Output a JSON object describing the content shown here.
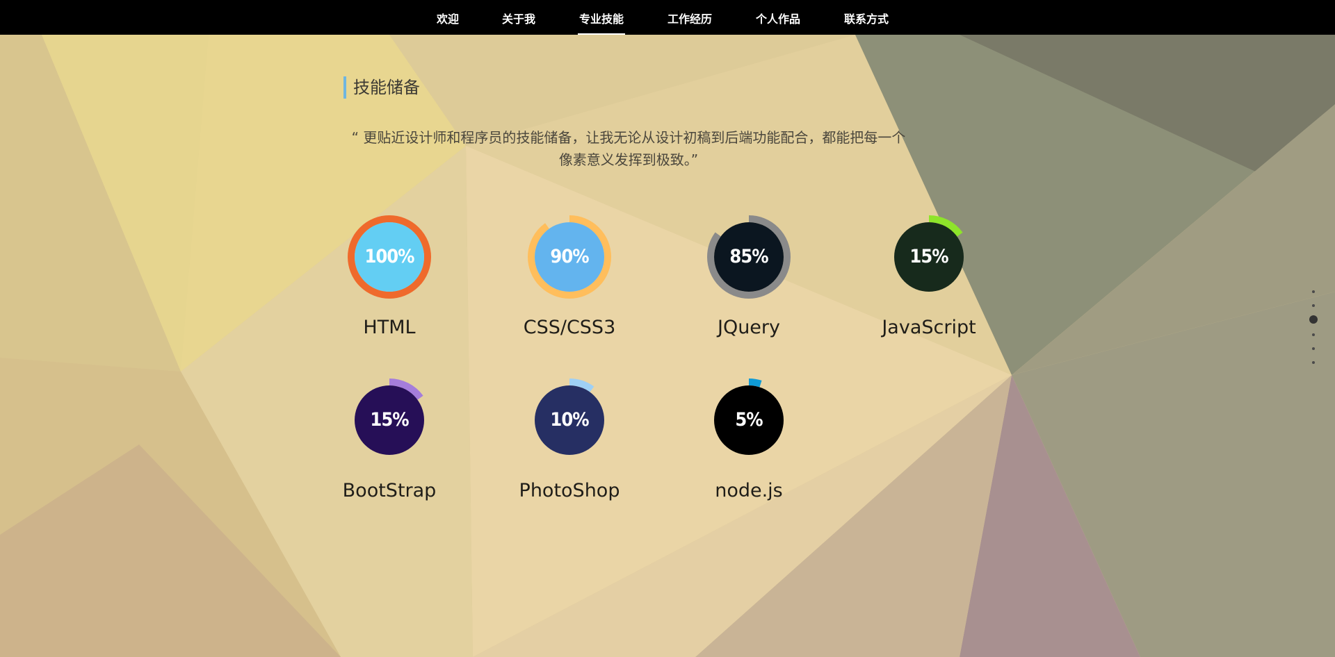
{
  "nav": {
    "items": [
      {
        "label": "欢迎",
        "active": false
      },
      {
        "label": "关于我",
        "active": false
      },
      {
        "label": "专业技能",
        "active": true
      },
      {
        "label": "工作经历",
        "active": false
      },
      {
        "label": "个人作品",
        "active": false
      },
      {
        "label": "联系方式",
        "active": false
      }
    ]
  },
  "section": {
    "title": "技能储备",
    "quote": "“ 更贴近设计师和程序员的技能储备，让我无论从设计初稿到后端功能配合，都能把每一个像素意义发挥到极致。”"
  },
  "skills": [
    {
      "name": "HTML",
      "percent_label": "100%",
      "percent": 100,
      "ring_color": "#ef6a2c",
      "track_color": "#ef6a2c",
      "fill_color": "#63cef3"
    },
    {
      "name": "CSS/CSS3",
      "percent_label": "90%",
      "percent": 90,
      "ring_color": "#ffbe5c",
      "track_color": "#ffbe5c",
      "fill_color": "#63b4ee"
    },
    {
      "name": "JQuery",
      "percent_label": "85%",
      "percent": 85,
      "ring_color": "#8a8a8a",
      "track_color": "#8a8a8a",
      "fill_color": "#0b1620"
    },
    {
      "name": "JavaScript",
      "percent_label": "15%",
      "percent": 15,
      "ring_color": "#8ee42a",
      "track_color": "#8ee42a",
      "fill_color": "#172a1c"
    },
    {
      "name": "BootStrap",
      "percent_label": "15%",
      "percent": 15,
      "ring_color": "#a57ddb",
      "track_color": "#a57ddb",
      "fill_color": "#260f57"
    },
    {
      "name": "PhotoShop",
      "percent_label": "10%",
      "percent": 10,
      "ring_color": "#9fd0f5",
      "track_color": "#9fd0f5",
      "fill_color": "#262f63"
    },
    {
      "name": "node.js",
      "percent_label": "5%",
      "percent": 5,
      "ring_color": "#0f9bd6",
      "track_color": "#0f9bd6",
      "fill_color": "#000000"
    }
  ],
  "side_dots": {
    "count": 6,
    "active_index": 2
  }
}
